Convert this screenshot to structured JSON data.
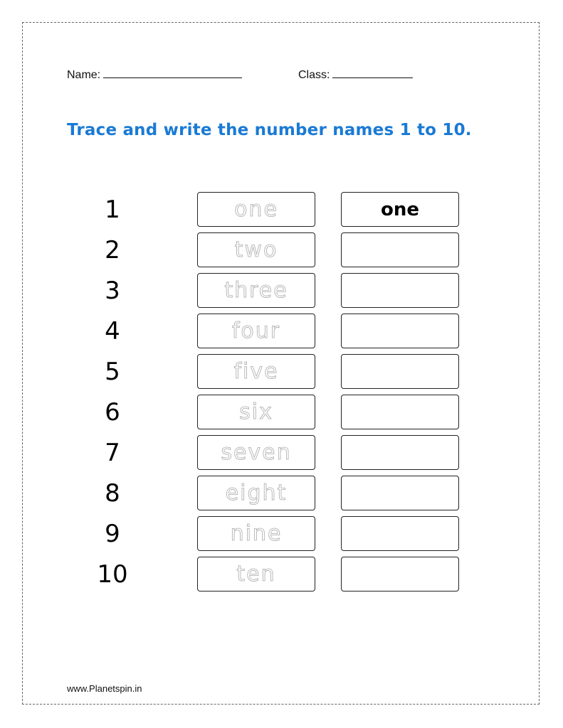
{
  "header": {
    "name_label": "Name:",
    "class_label": "Class:"
  },
  "title": "Trace and write the number names 1 to 10.",
  "rows": [
    {
      "number": "1",
      "trace": "one",
      "written": "one"
    },
    {
      "number": "2",
      "trace": "two",
      "written": ""
    },
    {
      "number": "3",
      "trace": "three",
      "written": ""
    },
    {
      "number": "4",
      "trace": "four",
      "written": ""
    },
    {
      "number": "5",
      "trace": "five",
      "written": ""
    },
    {
      "number": "6",
      "trace": "six",
      "written": ""
    },
    {
      "number": "7",
      "trace": "seven",
      "written": ""
    },
    {
      "number": "8",
      "trace": "eight",
      "written": ""
    },
    {
      "number": "9",
      "trace": "nine",
      "written": ""
    },
    {
      "number": "10",
      "trace": "ten",
      "written": ""
    }
  ],
  "footer": "www.Planetspin.in",
  "colors": {
    "title": "#1a7ad4",
    "trace_text": "#aaaaaa"
  }
}
